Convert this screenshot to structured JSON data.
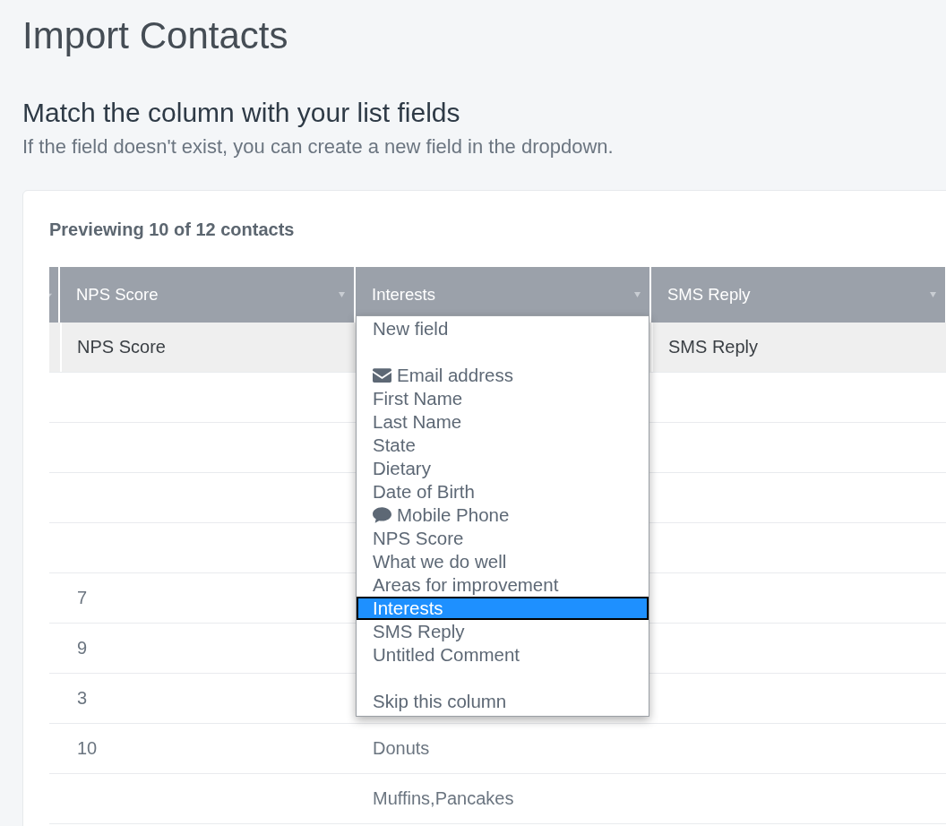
{
  "page": {
    "title": "Import Contacts",
    "heading": "Match the column with your list fields",
    "description": "If the field doesn't exist, you can create a new field in the dropdown."
  },
  "preview": {
    "summary": "Previewing 10 of 12 contacts"
  },
  "table": {
    "cut_off_left": true,
    "columns": [
      {
        "heading": "NPS Score",
        "open": false
      },
      {
        "heading": "Interests",
        "open": true
      },
      {
        "heading": "SMS Reply",
        "open": false
      }
    ],
    "rows": [
      {
        "kind": "field_names",
        "cells": [
          "NPS Score",
          null,
          "SMS Reply"
        ]
      },
      {
        "kind": "data",
        "cells": [
          null,
          null,
          null
        ]
      },
      {
        "kind": "data",
        "cells": [
          null,
          null,
          null
        ]
      },
      {
        "kind": "data",
        "cells": [
          null,
          null,
          null
        ]
      },
      {
        "kind": "data",
        "cells": [
          null,
          null,
          null
        ]
      },
      {
        "kind": "data",
        "cells": [
          "7",
          null,
          null
        ]
      },
      {
        "kind": "data",
        "cells": [
          "9",
          null,
          null
        ]
      },
      {
        "kind": "data",
        "cells": [
          "3",
          null,
          null
        ]
      },
      {
        "kind": "data",
        "cells": [
          "10",
          "Donuts",
          null
        ]
      },
      {
        "kind": "data",
        "cells": [
          null,
          "Muffins,Pancakes",
          null
        ]
      }
    ],
    "dropdown": {
      "option_groups": [
        [
          {
            "label": "New field",
            "kind": "plain",
            "selected": false
          }
        ],
        [
          {
            "label": "Email address",
            "kind": "email",
            "selected": false
          },
          {
            "label": "First Name",
            "kind": "plain",
            "selected": false
          },
          {
            "label": "Last Name",
            "kind": "plain",
            "selected": false
          },
          {
            "label": "State",
            "kind": "plain",
            "selected": false
          },
          {
            "label": "Dietary",
            "kind": "plain",
            "selected": false
          },
          {
            "label": "Date of Birth",
            "kind": "plain",
            "selected": false
          },
          {
            "label": "Mobile Phone",
            "kind": "phone",
            "selected": false
          },
          {
            "label": "NPS Score",
            "kind": "plain",
            "selected": false
          },
          {
            "label": "What we do well",
            "kind": "plain",
            "selected": false
          },
          {
            "label": "Areas for improvement",
            "kind": "plain",
            "selected": false
          },
          {
            "label": "Interests",
            "kind": "plain",
            "selected": true
          },
          {
            "label": "SMS Reply",
            "kind": "plain",
            "selected": false
          },
          {
            "label": "Untitled Comment",
            "kind": "plain",
            "selected": false
          }
        ],
        [
          {
            "label": "Skip this column",
            "kind": "plain",
            "selected": false
          }
        ]
      ]
    }
  }
}
